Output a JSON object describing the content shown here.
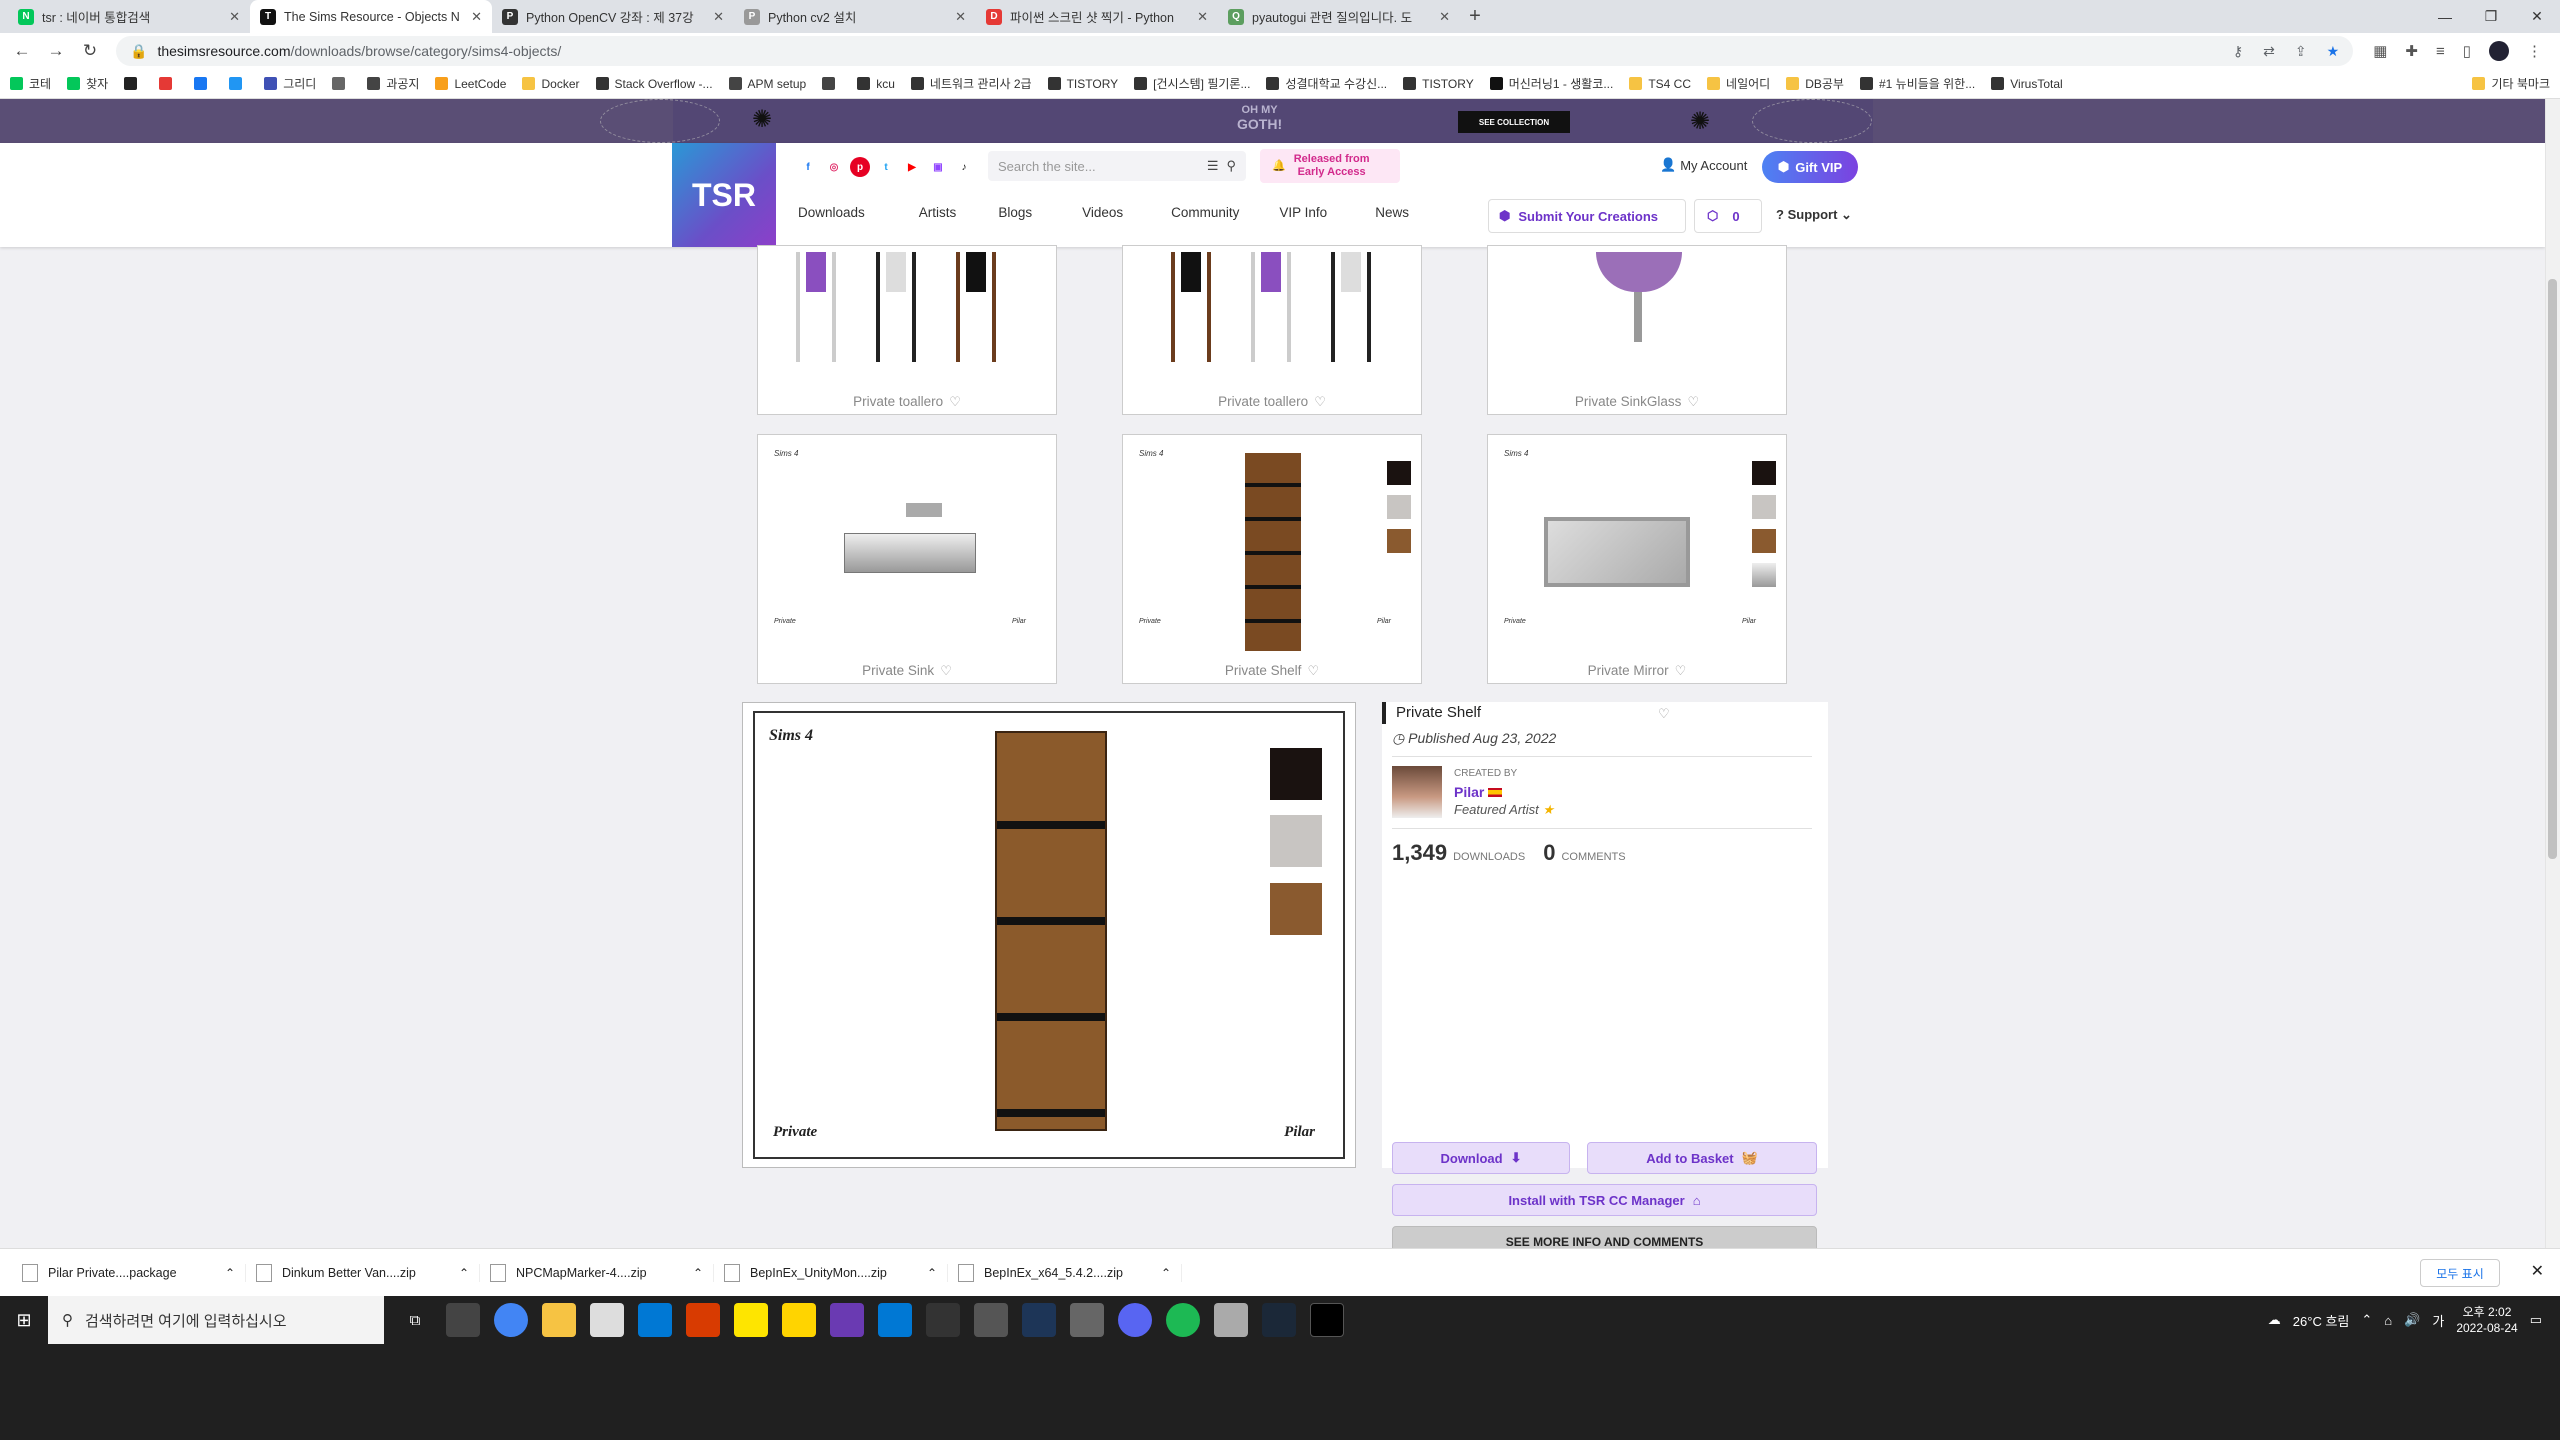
{
  "browser": {
    "tabs": [
      {
        "title": "tsr : 네이버 통합검색",
        "active": false,
        "fav_color": "#03c75a",
        "fav_glyph": "N"
      },
      {
        "title": "The Sims Resource - Objects N",
        "active": true,
        "fav_color": "#111111",
        "fav_glyph": "T"
      },
      {
        "title": "Python OpenCV 강좌 : 제 37강",
        "active": false,
        "fav_color": "#333333",
        "fav_glyph": "P"
      },
      {
        "title": "Python cv2 설치",
        "active": false,
        "fav_color": "#999999",
        "fav_glyph": "P"
      },
      {
        "title": "파이썬 스크린 샷 찍기 - Python",
        "active": false,
        "fav_color": "#e53935",
        "fav_glyph": "D"
      },
      {
        "title": "pyautogui 관련 질의입니다. 도",
        "active": false,
        "fav_color": "#5c9e5f",
        "fav_glyph": "Q"
      }
    ],
    "url_domain": "thesimsresource.com",
    "url_path": "/downloads/browse/category/sims4-objects/",
    "bookmarks": [
      {
        "label": "코테",
        "color": "#03c75a"
      },
      {
        "label": "찾자",
        "color": "#03c75a"
      },
      {
        "label": "",
        "color": "#222222"
      },
      {
        "label": "",
        "color": "#e53935"
      },
      {
        "label": "",
        "color": "#1877f2"
      },
      {
        "label": "",
        "color": "#2196f3"
      },
      {
        "label": "그리디",
        "color": "#3f51b5"
      },
      {
        "label": "",
        "color": "#666666"
      },
      {
        "label": "과공지",
        "color": "#444444"
      },
      {
        "label": "LeetCode",
        "color": "#f89f1b"
      },
      {
        "label": "Docker",
        "color": "#f6c343"
      },
      {
        "label": "Stack Overflow -...",
        "color": "#333333"
      },
      {
        "label": "APM setup",
        "color": "#444444"
      },
      {
        "label": "",
        "color": "#444444"
      },
      {
        "label": "kcu",
        "color": "#333333"
      },
      {
        "label": "네트워크 관리사 2급",
        "color": "#333333"
      },
      {
        "label": "TISTORY",
        "color": "#333333"
      },
      {
        "label": "[건시스템] 필기론...",
        "color": "#333333"
      },
      {
        "label": "성결대학교 수강신...",
        "color": "#333333"
      },
      {
        "label": "TISTORY",
        "color": "#333333"
      },
      {
        "label": "머신러닝1 - 생활코...",
        "color": "#111111"
      },
      {
        "label": "TS4 CC",
        "color": "#f6c343"
      },
      {
        "label": "네일어디",
        "color": "#f6c343"
      },
      {
        "label": "DB공부",
        "color": "#f6c343"
      },
      {
        "label": "#1 뉴비들을 위한...",
        "color": "#333333"
      },
      {
        "label": "VirusTotal",
        "color": "#333333"
      }
    ],
    "other_bookmarks": "기타 북마크"
  },
  "banner": {
    "goth_line1": "OH MY",
    "goth_line2": "GOTH!",
    "see_collection": "SEE COLLECTION"
  },
  "header": {
    "logo": "TSR",
    "social_icons": [
      "facebook-icon",
      "instagram-icon",
      "pinterest-icon",
      "twitter-icon",
      "youtube-icon",
      "twitch-icon",
      "tiktok-icon"
    ],
    "search_placeholder": "Search the site...",
    "early_line1": "Released from",
    "early_line2": "Early Access",
    "my_account": "My Account",
    "gift_vip": "Gift VIP",
    "nav": [
      "Downloads",
      "Artists",
      "Blogs",
      "Videos",
      "Community",
      "VIP Info",
      "News"
    ],
    "submit": "Submit Your Creations",
    "coins": "0",
    "support": "Support"
  },
  "grid": {
    "row1": [
      {
        "label": "Private toallero"
      },
      {
        "label": "Private toallero"
      },
      {
        "label": "Private SinkGlass"
      }
    ],
    "row2": [
      {
        "label": "Private Sink"
      },
      {
        "label": "Private Shelf"
      },
      {
        "label": "Private Mirror"
      }
    ],
    "watermark_top": "Sims 4",
    "watermark_left": "Private",
    "watermark_right": "Pilar"
  },
  "detail": {
    "title": "Private Shelf",
    "published": "Published Aug 23, 2022",
    "created_by": "CREATED BY",
    "author": "Pilar",
    "featured": "Featured Artist",
    "downloads_count": "1,349",
    "downloads_label": "DOWNLOADS",
    "comments_count": "0",
    "comments_label": "COMMENTS",
    "download_btn": "Download",
    "basket_btn": "Add to Basket",
    "install_btn": "Install with TSR CC Manager",
    "more_btn": "SEE MORE INFO AND COMMENTS",
    "image_top": "Sims 4",
    "image_left": "Private",
    "image_right": "Pilar"
  },
  "downloads_bar": {
    "items": [
      "Pilar Private....package",
      "Dinkum Better Van....zip",
      "NPCMapMarker-4....zip",
      "BepInEx_UnityMon....zip",
      "BepInEx_x64_5.4.2....zip"
    ],
    "show_all": "모두 표시"
  },
  "taskbar": {
    "search_placeholder": "검색하려면 여기에 입력하십시오",
    "weather": "26°C 흐림",
    "time": "오후 2:02",
    "date": "2022-08-24"
  }
}
